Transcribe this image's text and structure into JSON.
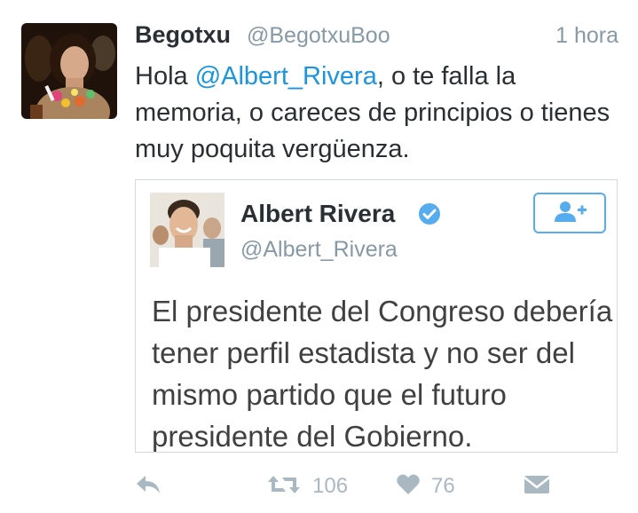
{
  "tweet": {
    "display_name": "Begotxu",
    "handle": "@BegotxuBoo",
    "time": "1 hora",
    "text_before": "Hola ",
    "mention": "@Albert_Rivera",
    "text_after": ", o te falla la memoria, o careces de principios o tienes muy poquita vergüenza."
  },
  "quoted": {
    "display_name": "Albert Rivera",
    "handle": "@Albert_Rivera",
    "text": "El presidente del Congreso debería tener perfil estadista y no ser del mismo partido que el futuro presidente del Gobierno."
  },
  "actions": {
    "retweets": "106",
    "likes": "76"
  },
  "colors": {
    "link": "#1b95e0",
    "muted": "#8899a6",
    "action": "#aab8c2",
    "verified": "#55acee"
  },
  "icons": [
    "reply-icon",
    "retweet-icon",
    "heart-icon",
    "message-icon",
    "verified-icon",
    "follow-icon"
  ]
}
